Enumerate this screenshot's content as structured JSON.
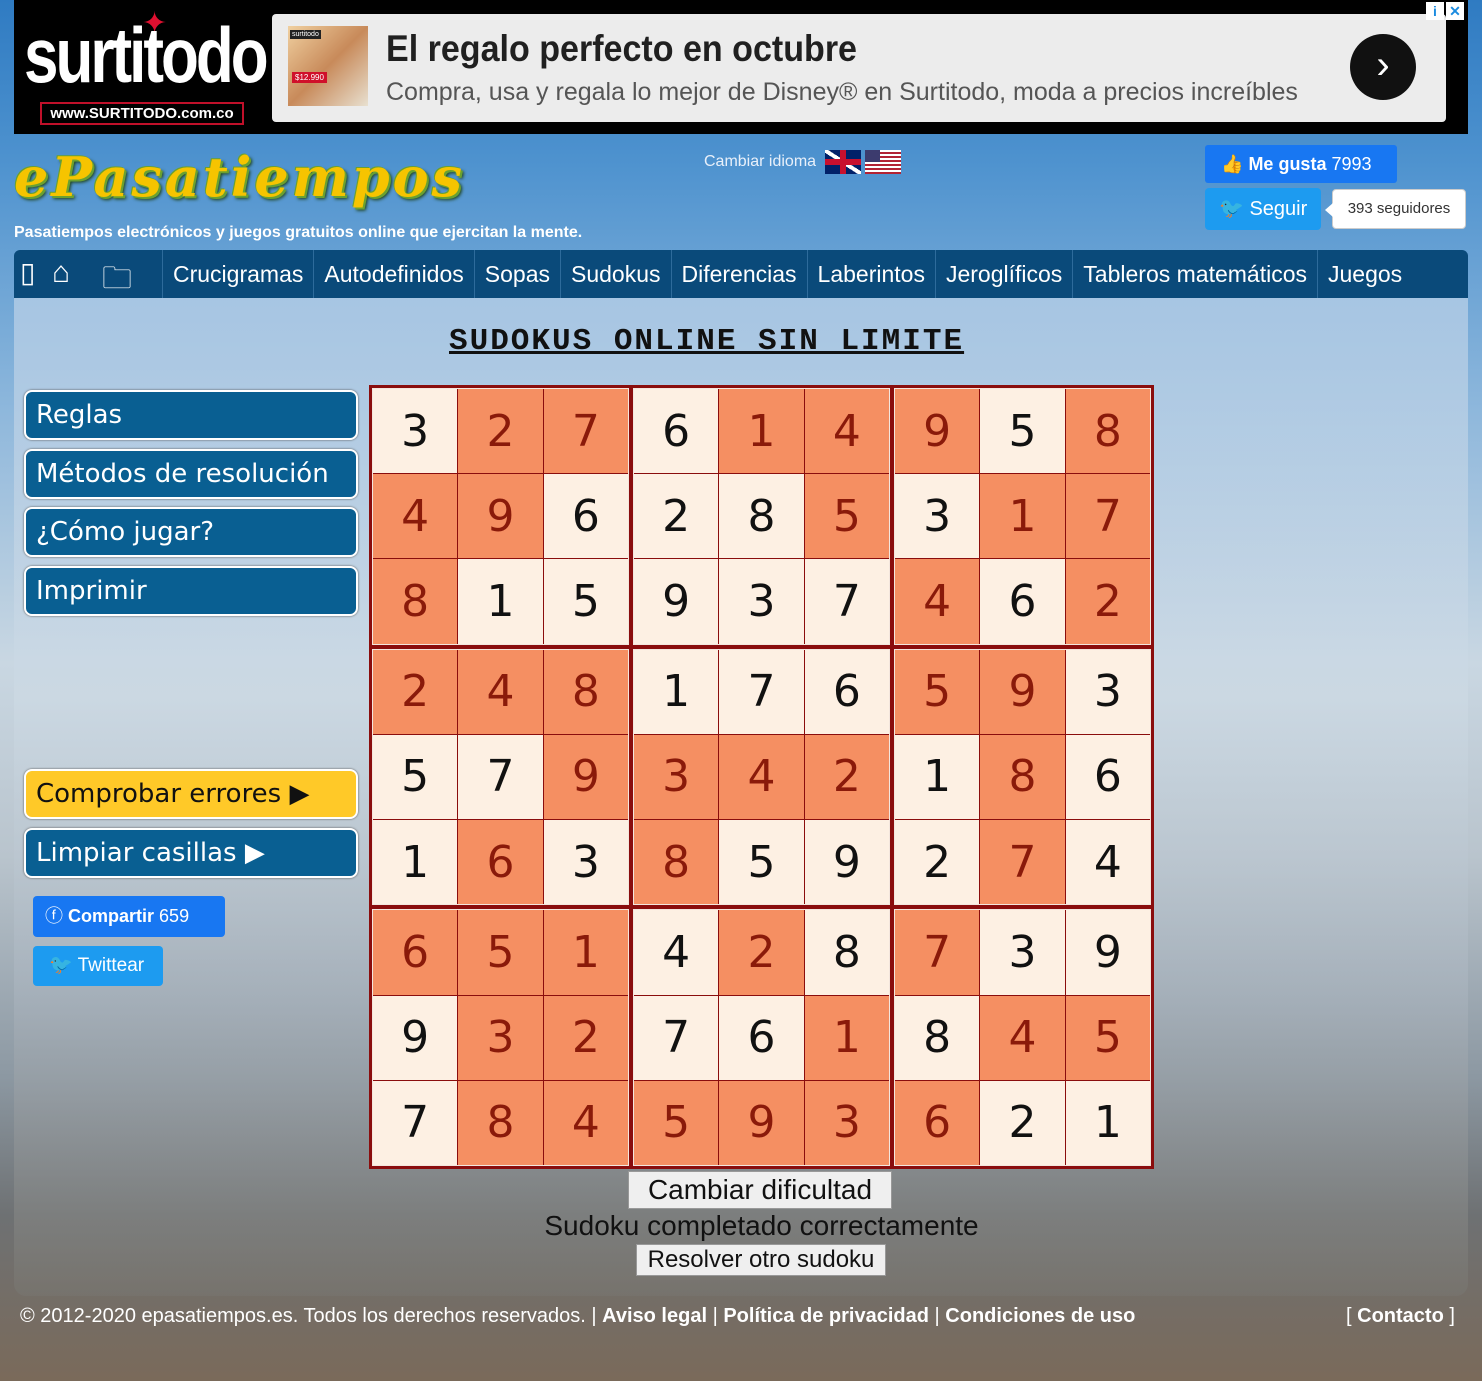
{
  "ad": {
    "brand": "surtitodo",
    "brand_url": "www.SURTITODO.com.co",
    "thumb_label": "surtitodo",
    "thumb_price": "$12.990",
    "title": "El regalo perfecto en octubre",
    "subtitle": "Compra, usa y regala lo mejor de Disney® en Surtitodo, moda a precios increíbles",
    "arrow": "›",
    "info_icon": "i",
    "close_icon": "✕"
  },
  "header": {
    "logo": "ePasatiempos",
    "tagline": "Pasatiempos electrónicos y juegos gratuitos online que ejercitan la mente.",
    "change_language": "Cambiar idioma",
    "fb_like_label": "Me gusta",
    "fb_like_count": "7993",
    "tw_follow_label": "Seguir",
    "tw_followers": "393 seguidores"
  },
  "nav": {
    "items": [
      "Crucigramas",
      "Autodefinidos",
      "Sopas",
      "Sudokus",
      "Diferencias",
      "Laberintos",
      "Jeroglíficos",
      "Tableros matemáticos",
      "Juegos"
    ]
  },
  "main": {
    "title": "SUDOKUS ONLINE SIN LIMITE",
    "side_buttons": [
      "Reglas",
      "Métodos de resolución",
      "¿Cómo jugar?",
      "Imprimir"
    ],
    "check_errors": "Comprobar errores ▶",
    "clear_cells": "Limpiar casillas ▶",
    "share_fb_label": "Compartir",
    "share_fb_count": "659",
    "share_tw_label": "Twittear",
    "change_difficulty": "Cambiar dificultad",
    "status": "Sudoku completado correctamente",
    "solve_another": "Resolver otro sudoku"
  },
  "sudoku": {
    "grid": [
      [
        3,
        2,
        7,
        6,
        1,
        4,
        9,
        5,
        8
      ],
      [
        4,
        9,
        6,
        2,
        8,
        5,
        3,
        1,
        7
      ],
      [
        8,
        1,
        5,
        9,
        3,
        7,
        4,
        6,
        2
      ],
      [
        2,
        4,
        8,
        1,
        7,
        6,
        5,
        9,
        3
      ],
      [
        5,
        7,
        9,
        3,
        4,
        2,
        1,
        8,
        6
      ],
      [
        1,
        6,
        3,
        8,
        5,
        9,
        2,
        7,
        4
      ],
      [
        6,
        5,
        1,
        4,
        2,
        8,
        7,
        3,
        9
      ],
      [
        9,
        3,
        2,
        7,
        6,
        1,
        8,
        4,
        5
      ],
      [
        7,
        8,
        4,
        5,
        9,
        3,
        6,
        2,
        1
      ]
    ],
    "highlighted": [
      [
        0,
        1,
        1,
        0,
        1,
        1,
        1,
        0,
        1
      ],
      [
        1,
        1,
        0,
        0,
        0,
        1,
        0,
        1,
        1
      ],
      [
        1,
        0,
        0,
        0,
        0,
        0,
        1,
        0,
        1
      ],
      [
        1,
        1,
        1,
        0,
        0,
        0,
        1,
        1,
        0
      ],
      [
        0,
        0,
        1,
        1,
        1,
        1,
        0,
        1,
        0
      ],
      [
        0,
        1,
        0,
        1,
        0,
        0,
        0,
        1,
        0
      ],
      [
        1,
        1,
        1,
        0,
        1,
        0,
        1,
        0,
        0
      ],
      [
        0,
        1,
        1,
        0,
        0,
        1,
        0,
        1,
        1
      ],
      [
        0,
        1,
        1,
        1,
        1,
        1,
        1,
        0,
        0
      ]
    ],
    "colors": {
      "light": "#fdf0e3",
      "highlight": "#f58f62",
      "border": "#8a0d0d"
    }
  },
  "footer": {
    "copyright": "© 2012-2020 epasatiempos.es. Todos los derechos reservados.",
    "sep": "|",
    "links": [
      "Aviso legal",
      "Política de privacidad",
      "Condiciones de uso"
    ],
    "contact": "Contacto"
  }
}
